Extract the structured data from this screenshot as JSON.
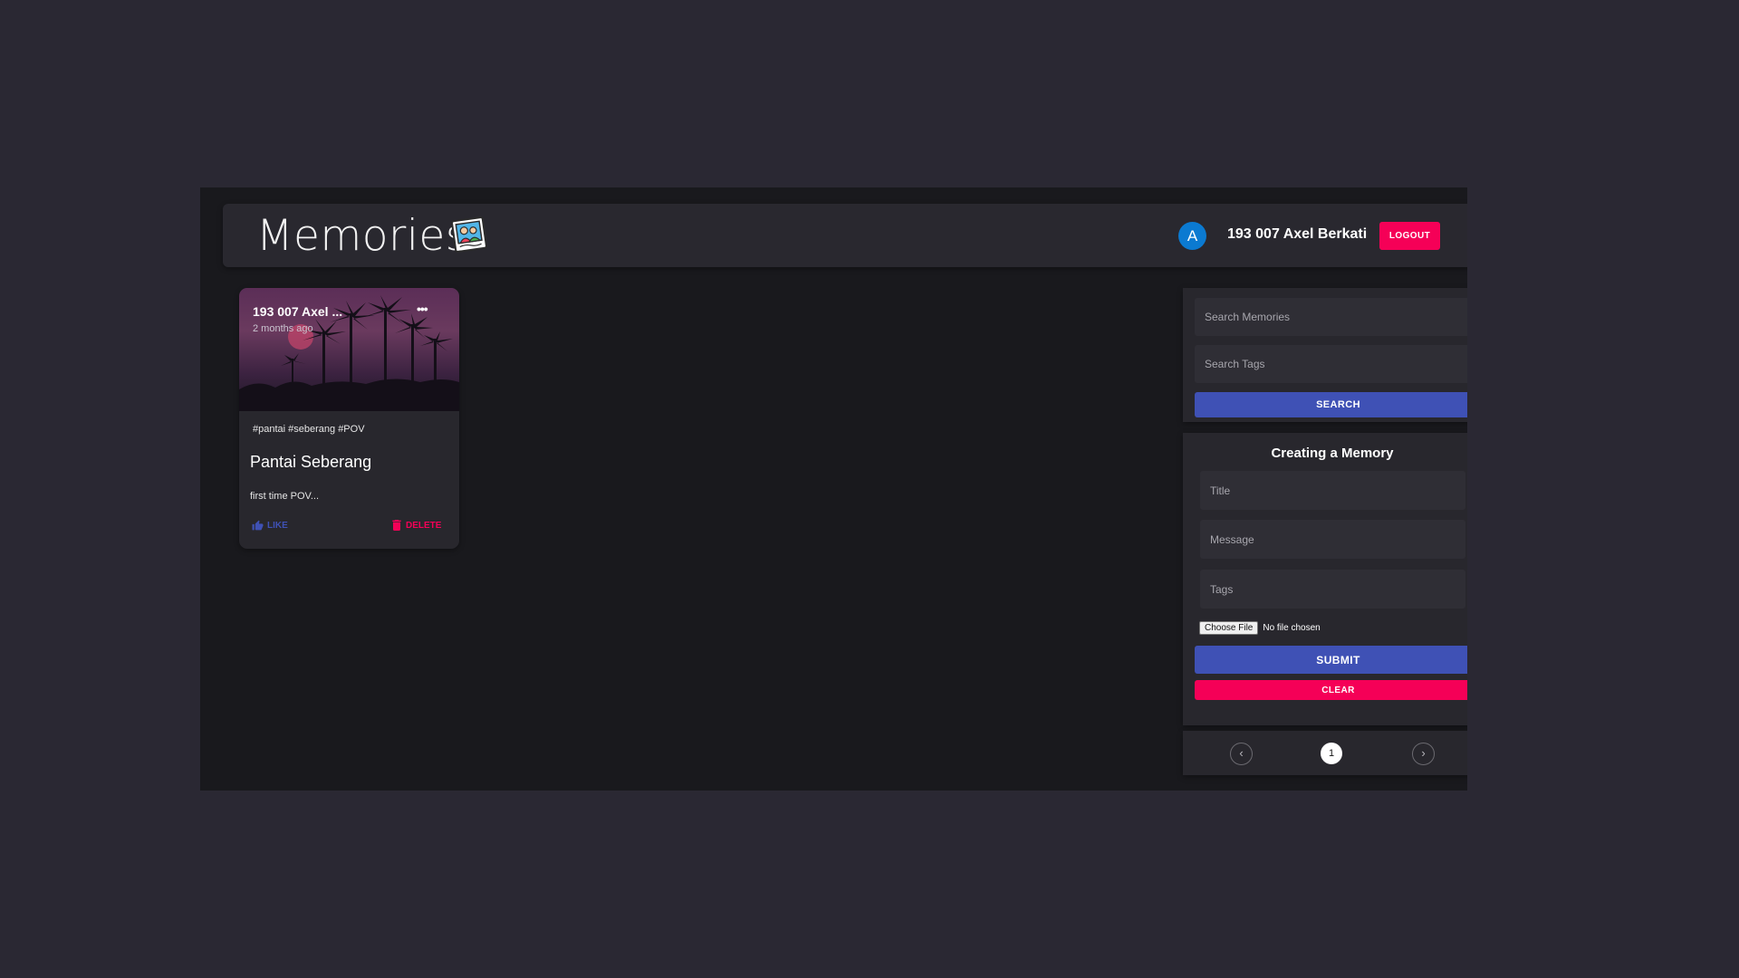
{
  "header": {
    "title": "Memories",
    "logo_icon": "photo-memories-icon",
    "user": {
      "avatar_letter": "A",
      "name": "193 007 Axel Berkati",
      "avatar_color": "#0b7ad1"
    },
    "logout_label": "LOGOUT"
  },
  "posts": [
    {
      "author": "193 007 Axel ...",
      "time": "2 months ago",
      "more_icon": "more-horiz-icon",
      "tags": "#pantai #seberang #POV",
      "title": "Pantai Seberang",
      "message": "first time POV...",
      "like_label": "LIKE",
      "delete_label": "DELETE"
    }
  ],
  "search": {
    "memories_placeholder": "Search Memories",
    "tags_placeholder": "Search Tags",
    "button_label": "SEARCH"
  },
  "form": {
    "heading": "Creating a Memory",
    "title_placeholder": "Title",
    "message_placeholder": "Message",
    "tags_placeholder": "Tags",
    "file_button_label": "Choose File",
    "file_status": "No file chosen",
    "submit_label": "SUBMIT",
    "clear_label": "CLEAR"
  },
  "pagination": {
    "current_page": "1",
    "prev_icon": "chevron-left-icon",
    "next_icon": "chevron-right-icon"
  },
  "colors": {
    "primary": "#3f51b5",
    "secondary": "#f50057",
    "background": "#19191d",
    "surface": "#28272d"
  }
}
